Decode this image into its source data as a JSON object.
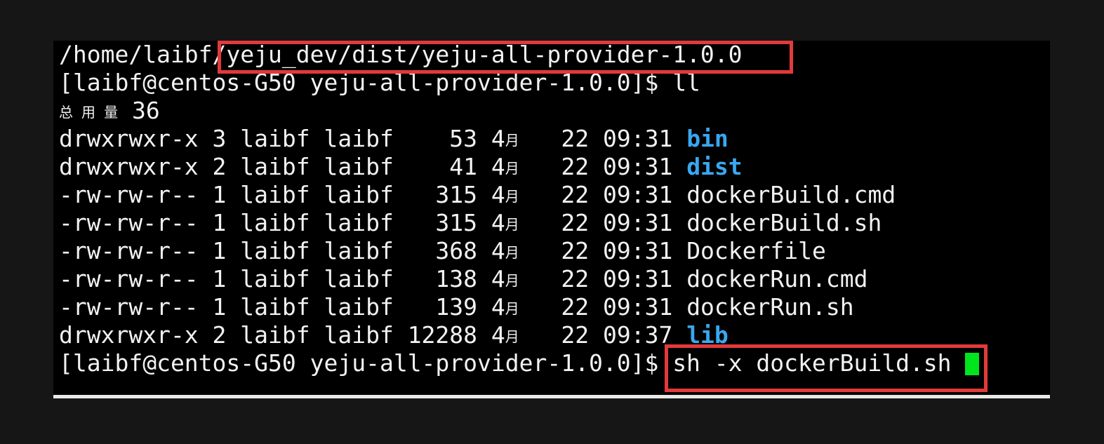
{
  "terminal": {
    "path_prefix": "/home/laibf/",
    "path_highlighted": "yeju_dev/dist/yeju-all-provider-1.0.0",
    "prompt": "[laibf@centos-G50 yeju-all-provider-1.0.0]$ ",
    "first_command": "ll",
    "total_label": "总 用 量",
    "total_value": " 36",
    "month_label": "月",
    "listing": [
      {
        "perms": "drwxrwxr-x",
        "links": "3",
        "owner": "laibf",
        "group": "laibf",
        "size": "53",
        "month": "4",
        "day": "22",
        "time": "09:31",
        "name": "bin",
        "is_dir": true
      },
      {
        "perms": "drwxrwxr-x",
        "links": "2",
        "owner": "laibf",
        "group": "laibf",
        "size": "41",
        "month": "4",
        "day": "22",
        "time": "09:31",
        "name": "dist",
        "is_dir": true
      },
      {
        "perms": "-rw-rw-r--",
        "links": "1",
        "owner": "laibf",
        "group": "laibf",
        "size": "315",
        "month": "4",
        "day": "22",
        "time": "09:31",
        "name": "dockerBuild.cmd",
        "is_dir": false
      },
      {
        "perms": "-rw-rw-r--",
        "links": "1",
        "owner": "laibf",
        "group": "laibf",
        "size": "315",
        "month": "4",
        "day": "22",
        "time": "09:31",
        "name": "dockerBuild.sh",
        "is_dir": false
      },
      {
        "perms": "-rw-rw-r--",
        "links": "1",
        "owner": "laibf",
        "group": "laibf",
        "size": "368",
        "month": "4",
        "day": "22",
        "time": "09:31",
        "name": "Dockerfile",
        "is_dir": false
      },
      {
        "perms": "-rw-rw-r--",
        "links": "1",
        "owner": "laibf",
        "group": "laibf",
        "size": "138",
        "month": "4",
        "day": "22",
        "time": "09:31",
        "name": "dockerRun.cmd",
        "is_dir": false
      },
      {
        "perms": "-rw-rw-r--",
        "links": "1",
        "owner": "laibf",
        "group": "laibf",
        "size": "139",
        "month": "4",
        "day": "22",
        "time": "09:31",
        "name": "dockerRun.sh",
        "is_dir": false
      },
      {
        "perms": "drwxrwxr-x",
        "links": "2",
        "owner": "laibf",
        "group": "laibf",
        "size": "12288",
        "month": "4",
        "day": "22",
        "time": "09:37",
        "name": "lib",
        "is_dir": true
      }
    ],
    "current_command": "sh -x dockerBuild.sh ",
    "colors": {
      "background": "#000000",
      "text": "#f2f2f2",
      "directory": "#3aa7f0",
      "cursor": "#00e61d",
      "highlight_box": "#e23a3a"
    }
  }
}
